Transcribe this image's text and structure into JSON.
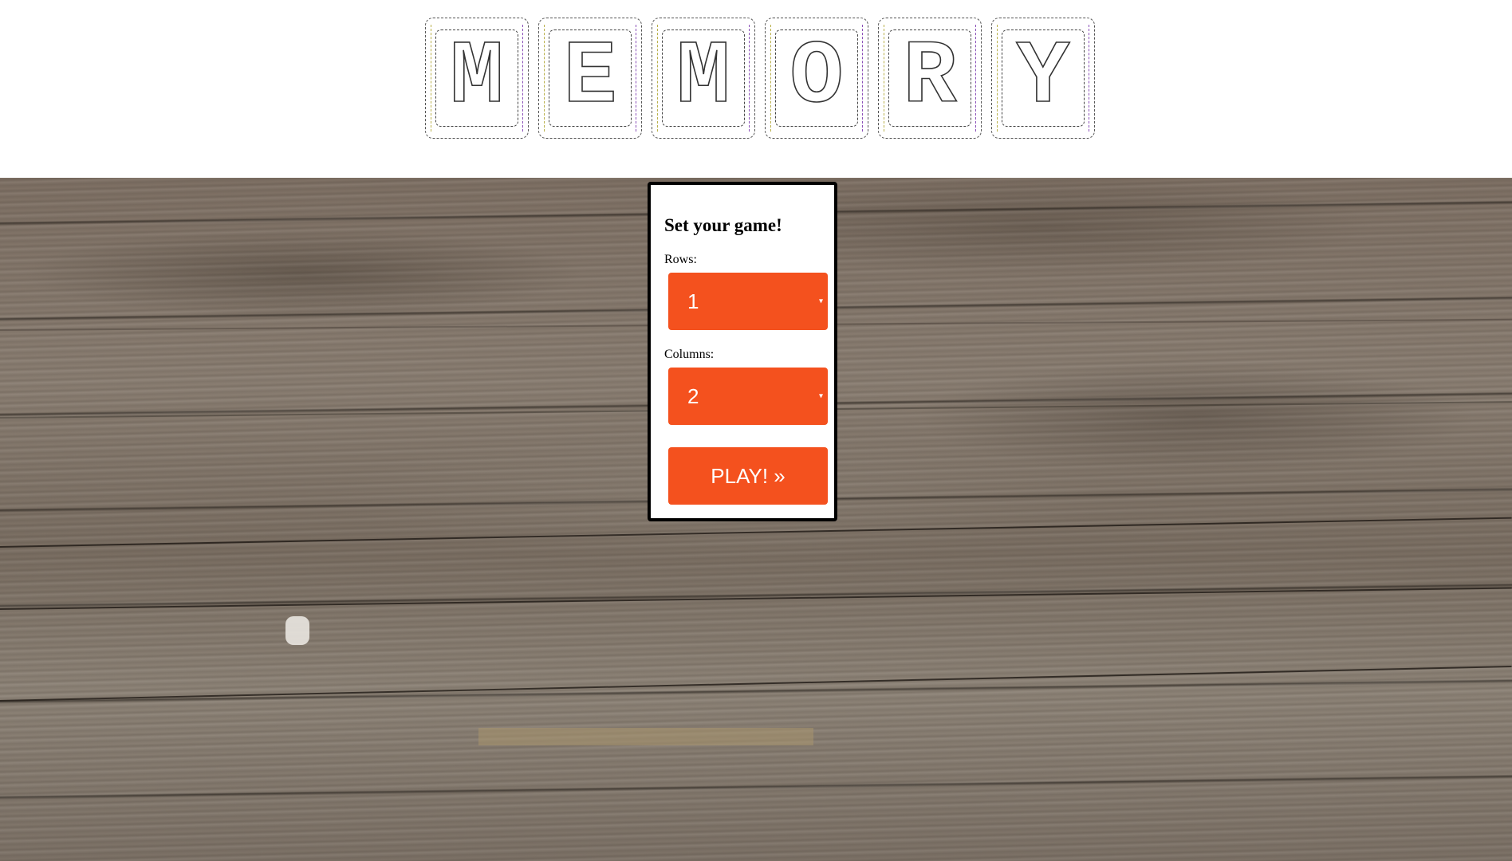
{
  "title": {
    "letters": [
      "M",
      "E",
      "M",
      "O",
      "R",
      "Y"
    ]
  },
  "settings": {
    "heading": "Set your game!",
    "rows_label": "Rows:",
    "rows_value": "1",
    "columns_label": "Columns:",
    "columns_value": "2",
    "play_label": "PLAY! »",
    "caret_icon": "▾"
  },
  "colors": {
    "accent": "#f4511e",
    "card_border": "#000000",
    "background_top": "#ffffff"
  },
  "icons": {
    "dropdown": "caret-down-icon"
  }
}
